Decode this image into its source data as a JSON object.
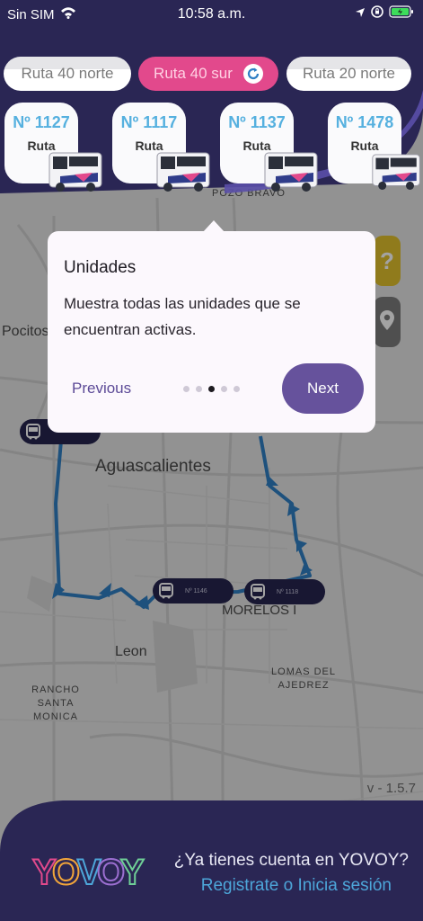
{
  "status_bar": {
    "carrier": "Sin SIM",
    "time": "10:58 a.m."
  },
  "routes": [
    {
      "label": "Ruta 40 norte",
      "active": false
    },
    {
      "label": "Ruta 40 sur",
      "active": true
    },
    {
      "label": "Ruta 20 norte",
      "active": false
    }
  ],
  "units": [
    {
      "number": "Nº 1127",
      "route_label": "Ruta"
    },
    {
      "number": "Nº 1117",
      "route_label": "Ruta"
    },
    {
      "number": "Nº 1137",
      "route_label": "Ruta"
    },
    {
      "number": "Nº 1478",
      "route_label": "Ruta"
    }
  ],
  "map": {
    "places": {
      "pozo_bravo": "POZO BRAVO",
      "pocitos": "Pocitos",
      "aguascalientes": "Aguascalientes",
      "morelos": "MORELOS I",
      "leon": "Leon",
      "rancho_1": "RANCHO SANTA",
      "rancho_2": "MONICA",
      "lomas_1": "LOMAS DEL",
      "lomas_2": "AJEDREZ"
    },
    "buses": [
      {
        "number": "Nº 1146"
      },
      {
        "number": "Nº 1118"
      }
    ],
    "version": "v - 1.5.7"
  },
  "tooltip": {
    "title": "Unidades",
    "description": "Muestra todas las unidades que se encuentran activas.",
    "previous": "Previous",
    "next": "Next",
    "step": 3,
    "total_steps": 5
  },
  "footer": {
    "logo_text": "YOVOY",
    "question": "¿Ya tienes cuenta en YOVOY?",
    "cta": "Registrate o Inicia sesión"
  },
  "colors": {
    "header_bg": "#2a2654",
    "active_chip": "#e2498c",
    "unit_number": "#55b0df",
    "next_button": "#66529c",
    "route_line": "#2f7fc4",
    "help_button": "#c9a51f",
    "location_button": "#6a6a6a",
    "cta_link": "#4da6d9"
  }
}
